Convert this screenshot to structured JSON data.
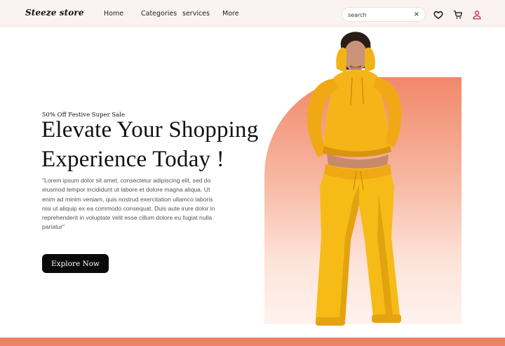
{
  "brand": {
    "name": "Steeze store"
  },
  "nav": {
    "items": [
      {
        "label": "Home"
      },
      {
        "label": "Categories"
      },
      {
        "label": "services"
      },
      {
        "label": "More"
      }
    ],
    "search": {
      "value": "search",
      "clear_glyph": "×"
    },
    "icons": [
      "heart-icon",
      "cart-icon",
      "user-icon"
    ]
  },
  "hero": {
    "promo": "50% Off Festive Super Sale",
    "headline_line1": "Elevate Your Shopping",
    "headline_line2": "Experience Today !",
    "body": "\"Lorem ipsum dolor sit amet, consectetur adipiscing elit, sed do eiusmod tempor incididunt ut labore et dolore magna aliqua. Ut enim ad minim veniam, quis nostrud exercitation ullamco laboris nisi ut aliquip ex ea commodo consequat. Duis aute irure dolor in reprehenderit in voluptate velit esse cillum dolore eu fugiat nulla pariatur\"",
    "cta_label": "Explore Now"
  },
  "colors": {
    "accent": "#ea8463",
    "panel_top": "#f2886a",
    "nav_bg": "#fbf3f1",
    "outfit": "#f5b518",
    "icon": "#c2394d"
  }
}
